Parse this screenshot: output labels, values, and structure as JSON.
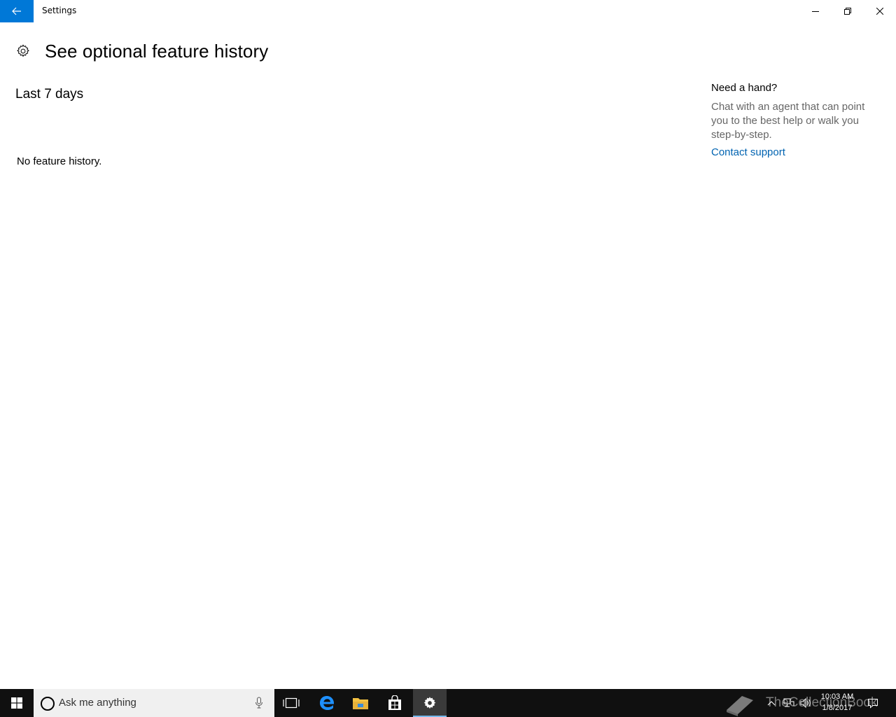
{
  "window": {
    "title": "Settings",
    "back_icon": "arrow-left-icon",
    "controls": [
      "minimize-icon",
      "restore-icon",
      "close-icon"
    ]
  },
  "page": {
    "icon": "gear-icon",
    "title": "See optional feature history",
    "section_title": "Last 7 days",
    "empty_message": "No feature history."
  },
  "help": {
    "title": "Need a hand?",
    "description": "Chat with an agent that can point you to the best help or walk you step-by-step.",
    "link_label": "Contact support"
  },
  "taskbar": {
    "search_placeholder": "Ask me anything",
    "pinned_icons": [
      "task-view-icon",
      "edge-icon",
      "file-explorer-icon",
      "store-icon",
      "settings-icon"
    ],
    "active_app": "settings-icon",
    "watermark": "TheCollectionBook",
    "time": "10:03 AM",
    "date": "1/8/2017"
  },
  "colors": {
    "accent": "#0078d7",
    "link": "#0063b1",
    "taskbar": "#101010"
  }
}
